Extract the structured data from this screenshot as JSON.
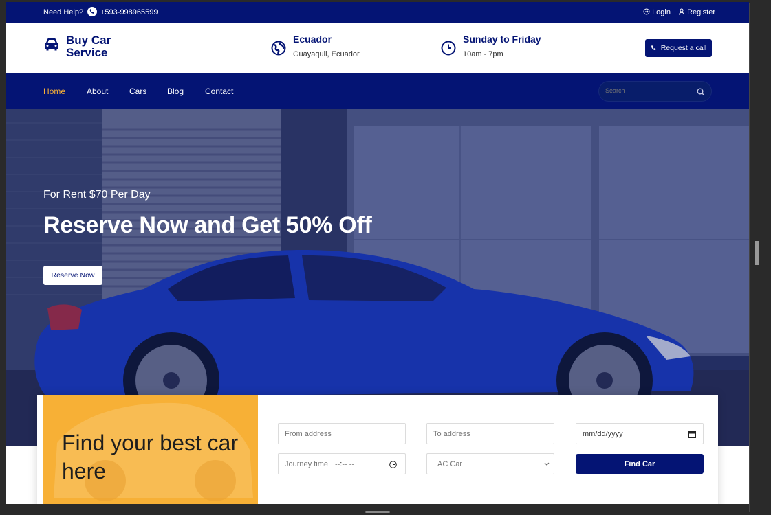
{
  "topbar": {
    "help_label": "Need Help?",
    "phone_icon": "phone-icon",
    "phone": "+593-998965599",
    "login": "Login",
    "login_icon": "login-icon",
    "register": "Register",
    "register_icon": "user-icon"
  },
  "header": {
    "brand_icon": "car-icon",
    "brand_line1": "Buy Car",
    "brand_line2": "Service",
    "location_icon": "globe-icon",
    "location_title": "Ecuador",
    "location_sub": "Guayaquil, Ecuador",
    "hours_icon": "clock-icon",
    "hours_title": "Sunday to Friday",
    "hours_sub": "10am - 7pm",
    "call_button": "Request a call",
    "call_icon": "phone-icon"
  },
  "nav": {
    "items": [
      {
        "label": "Home",
        "active": true
      },
      {
        "label": "About"
      },
      {
        "label": "Cars"
      },
      {
        "label": "Blog"
      },
      {
        "label": "Contact"
      }
    ],
    "search_placeholder": "Search",
    "search_icon": "search-icon"
  },
  "hero": {
    "subtitle": "For Rent $70 Per Day",
    "title": "Reserve Now and Get 50% Off",
    "button": "Reserve Now"
  },
  "find": {
    "title": "Find your best car here",
    "from_placeholder": "From address",
    "to_placeholder": "To address",
    "date_placeholder": "mm/dd/yyyy",
    "time_label": "Journey time",
    "time_value": "--:-- --",
    "car_type": "AC Car",
    "button": "Find Car"
  },
  "colors": {
    "primary": "#041474",
    "accent": "#f7b036"
  }
}
